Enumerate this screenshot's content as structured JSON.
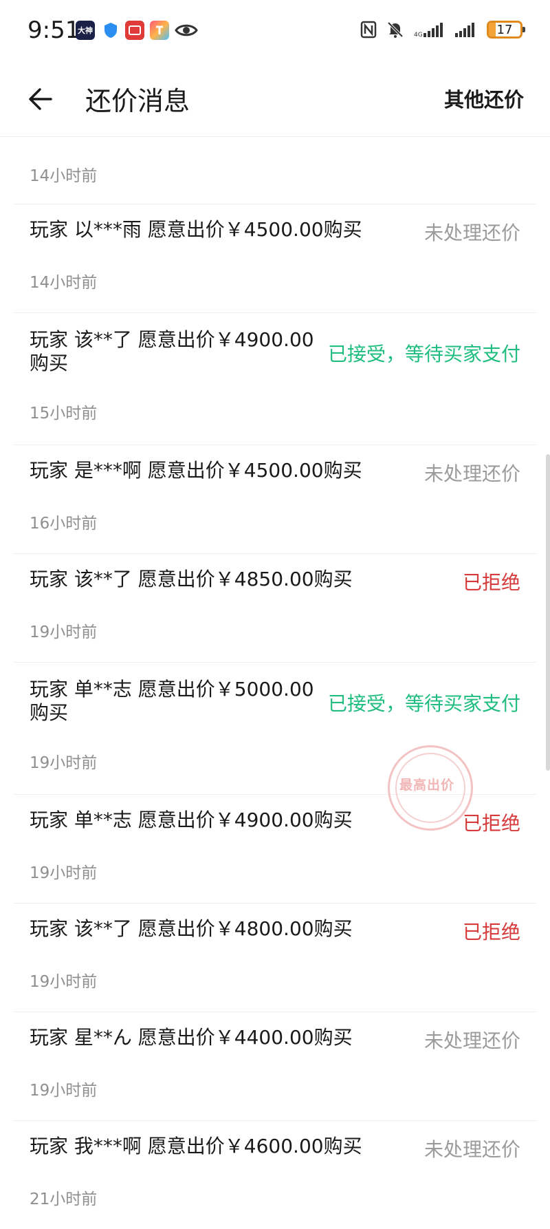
{
  "status_bar": {
    "time": "9:51",
    "battery": "17",
    "notif_dashen": "大神"
  },
  "header": {
    "title": "还价消息",
    "right_action": "其他还价"
  },
  "list": {
    "top_time": "14小时前",
    "items": [
      {
        "text": "玩家 以***雨 愿意出价￥4500.00购买",
        "status": "未处理还价",
        "status_type": "pending",
        "time": "14小时前"
      },
      {
        "text": "玩家 该**了 愿意出价￥4900.00购买",
        "status": "已接受，等待买家支付",
        "status_type": "accepted",
        "time": "15小时前"
      },
      {
        "text": "玩家 是***啊 愿意出价￥4500.00购买",
        "status": "未处理还价",
        "status_type": "pending",
        "time": "16小时前"
      },
      {
        "text": "玩家 该**了 愿意出价￥4850.00购买",
        "status": "已拒绝",
        "status_type": "rejected",
        "time": "19小时前"
      },
      {
        "text": "玩家 单**志 愿意出价￥5000.00购买",
        "status": "已接受，等待买家支付",
        "status_type": "accepted",
        "time": "19小时前"
      },
      {
        "text": "玩家 单**志 愿意出价￥4900.00购买",
        "status": "已拒绝",
        "status_type": "rejected",
        "time": "19小时前"
      },
      {
        "text": "玩家 该**了 愿意出价￥4800.00购买",
        "status": "已拒绝",
        "status_type": "rejected",
        "time": "19小时前"
      },
      {
        "text": "玩家 星**ん 愿意出价￥4400.00购买",
        "status": "未处理还价",
        "status_type": "pending",
        "time": "19小时前"
      },
      {
        "text": "玩家 我***啊 愿意出价￥4600.00购买",
        "status": "未处理还价",
        "status_type": "pending",
        "time": "21小时前"
      }
    ]
  },
  "stamp": {
    "text": "最高出价"
  },
  "colors": {
    "accepted": "#1fbd80",
    "rejected": "#d63a3a",
    "pending": "#9b9b9b"
  }
}
